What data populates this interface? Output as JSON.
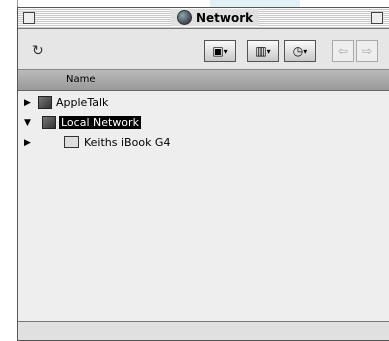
{
  "window": {
    "title": "Network"
  },
  "toolbar": {
    "refresh_icon": "refresh-icon",
    "buttons": [
      {
        "icon": "server-icon",
        "label": "▾"
      },
      {
        "icon": "books-icon",
        "label": "▾"
      },
      {
        "icon": "clock-icon",
        "label": "▾"
      }
    ],
    "back_label": "⇦",
    "forward_label": "⇨"
  },
  "list": {
    "column_name": "Name",
    "rows": [
      {
        "label": "AppleTalk",
        "expanded": false,
        "selected": false
      },
      {
        "label": "Local Network",
        "expanded": true,
        "selected": true
      },
      {
        "label": "Keiths iBook G4",
        "expanded": false,
        "selected": false
      }
    ]
  }
}
